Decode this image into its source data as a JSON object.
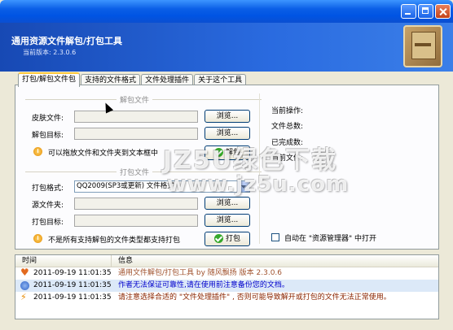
{
  "app": {
    "title": "通用资源文件解包/打包工具",
    "version": "当前版本: 2.3.0.6"
  },
  "tabs": [
    {
      "label": "打包/解包文件包",
      "active": true
    },
    {
      "label": "支持的文件格式",
      "active": false
    },
    {
      "label": "文件处理插件",
      "active": false
    },
    {
      "label": "关于这个工具",
      "active": false
    }
  ],
  "unpack": {
    "group_title": "解包文件",
    "skin_label": "皮肤文件:",
    "skin_value": "",
    "target_label": "解包目标:",
    "target_value": "",
    "browse_label": "浏览...",
    "hint": "可以拖放文件和文件夹到文本框中",
    "unpack_button": "解包"
  },
  "pack": {
    "group_title": "打包文件",
    "format_label": "打包格式:",
    "format_value": "QQ2009(SP3或更新) 文件格式",
    "source_label": "源文件夹:",
    "source_value": "",
    "target_label": "打包目标:",
    "target_value": "",
    "browse_label": "浏览...",
    "hint": "不是所有支持解包的文件类型都支持打包",
    "pack_button": "打包"
  },
  "status": {
    "current_op": "当前操作:",
    "total_files": "文件总数:",
    "completed": "已完成数:",
    "current_file": "当前文件:",
    "open_in_explorer": "自动在 \"资源管理器\" 中打开",
    "open_in_explorer_checked": false
  },
  "log": {
    "col_time": "时间",
    "col_info": "信息",
    "rows": [
      {
        "icon": "heart-icon",
        "time": "2011-09-19 11:01:35",
        "message": "通用文件解包/打包工具 by 随风飘扬 版本 2.3.0.6",
        "color": "#a0522d",
        "bg": "#ffffff"
      },
      {
        "icon": "info-icon",
        "time": "2011-09-19 11:01:35",
        "message": "作者无法保证可靠性,请在使用前注意备份您的文档。",
        "color": "#0000cc",
        "bg": "#dce9f8"
      },
      {
        "icon": "bolt-icon",
        "time": "2011-09-19 11:01:35",
        "message": "请注意选择合适的 \"文件处理插件\" , 否则可能导致解开或打包的文件无法正常使用。",
        "color": "#8b2500",
        "bg": "#ffffff"
      }
    ]
  },
  "watermark": {
    "line1": "JZ5U绿色下载",
    "line2": "www.jz5u.com"
  }
}
